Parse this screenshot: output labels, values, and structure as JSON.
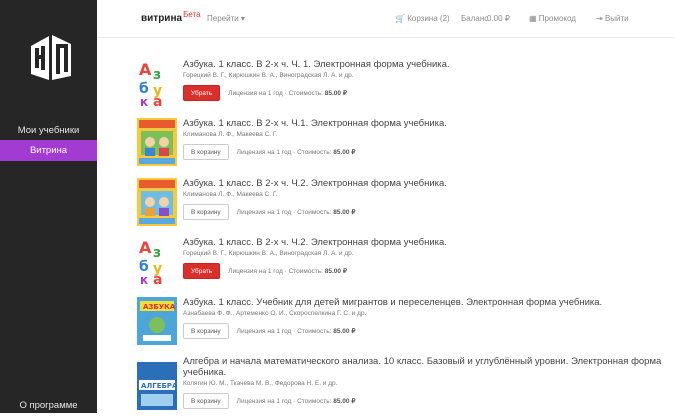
{
  "sidebar": {
    "items": [
      {
        "label": "Мои учебники",
        "active": false
      },
      {
        "label": "Витрина",
        "active": true
      },
      {
        "label": "О программе",
        "active": false
      }
    ]
  },
  "topbar": {
    "brand": "витрина",
    "beta": "Бета",
    "goto": "Перейти ▾",
    "cart": "Корзина (2)",
    "balance_label": "Баланс",
    "balance_value": "0.00 ₽",
    "promo": "Промокод",
    "logout": "Выйти"
  },
  "books": [
    {
      "title": "Азбука. 1 класс. В 2-х ч. Ч. 1. Электронная форма учебника.",
      "authors": "Горецкий В. Г., Кирюшкин В. А., Виноградская Л. А. и др.",
      "action": "Убрать",
      "in_cart": true,
      "license": "Лицензия на 1 год",
      "price_label": "Стоимость:",
      "price": "85.00 ₽",
      "cover": "azbuka"
    },
    {
      "title": "Азбука. 1 класс. В 2-х ч. Ч.1. Электронная форма учебника.",
      "authors": "Климанова Л. Ф., Макеева С. Г.",
      "action": "В корзину",
      "in_cart": false,
      "license": "Лицензия на 1 год",
      "price_label": "Стоимость:",
      "price": "85.00 ₽",
      "cover": "kids"
    },
    {
      "title": "Азбука. 1 класс. В 2-х ч. Ч.2. Электронная форма учебника.",
      "authors": "Климанова Л. Ф., Макеева С. Г.",
      "action": "В корзину",
      "in_cart": false,
      "license": "Лицензия на 1 год",
      "price_label": "Стоимость:",
      "price": "85.00 ₽",
      "cover": "kids"
    },
    {
      "title": "Азбука. 1 класс. В 2-х ч. Ч.2. Электронная форма учебника.",
      "authors": "Горецкий В. Г., Кирюшкин В. А., Виноградская Л. А. и др.",
      "action": "Убрать",
      "in_cart": true,
      "license": "Лицензия на 1 год",
      "price_label": "Стоимость:",
      "price": "85.00 ₽",
      "cover": "azbuka"
    },
    {
      "title": "Азбука. 1 класс. Учебник для детей мигрантов и переселенцев. Электронная форма учебника.",
      "authors": "Азнабаева Ф. Ф., Артеменко О. И., Скороспелкина Г. С. и др.",
      "action": "В корзину",
      "in_cart": false,
      "license": "Лицензия на 1 год",
      "price_label": "Стоимость:",
      "price": "85.00 ₽",
      "cover": "migrant"
    },
    {
      "title": "Алгебра и начала математического анализа. 10 класс. Базовый и углублённый уровни. Электронная форма учебника.",
      "authors": "Колягин Ю. М., Ткачева М. В., Федорова Н. Е. и др.",
      "action": "В корзину",
      "in_cart": false,
      "license": "Лицензия на 1 год",
      "price_label": "Стоимость:",
      "price": "85.00 ₽",
      "cover": "algebra"
    }
  ],
  "colors": {
    "sidebar_bg": "#262626",
    "active": "#a23bd1",
    "remove": "#d9302c"
  }
}
